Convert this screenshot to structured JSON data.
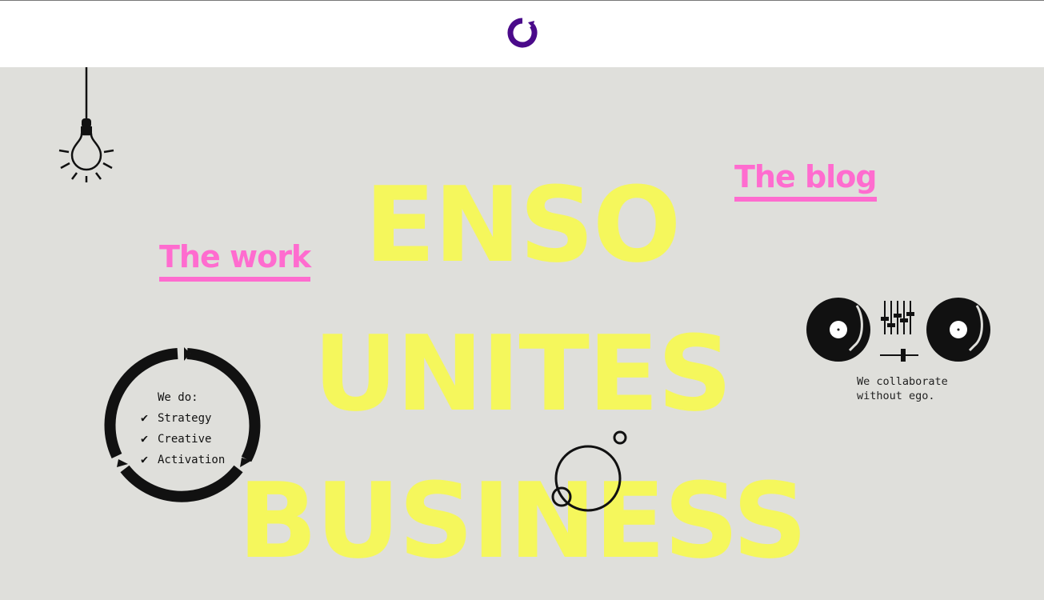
{
  "header": {
    "logo_icon": "enso-circle-logo-icon",
    "logo_color": "#4a0a8a"
  },
  "hero": {
    "line1": "ENSO",
    "line2": "UNITES",
    "line3": "BUSINESS",
    "color": "#f5f75c"
  },
  "nav": {
    "work_label": "The work",
    "blog_label": "The blog",
    "color": "#ff6ccf"
  },
  "services": {
    "heading": "We do:",
    "items": [
      "Strategy",
      "Creative",
      "Activation"
    ],
    "icon": "cycle-arrows-icon",
    "check_icon": "checkmark-icon"
  },
  "collab": {
    "caption_line1": "We collaborate",
    "caption_line2": "without ego.",
    "icon": "dj-turntables-icon"
  },
  "decor": {
    "bulb_icon": "lightbulb-icon",
    "orbit_icon": "orbit-circles-icon"
  },
  "background": "#dfdfdb"
}
